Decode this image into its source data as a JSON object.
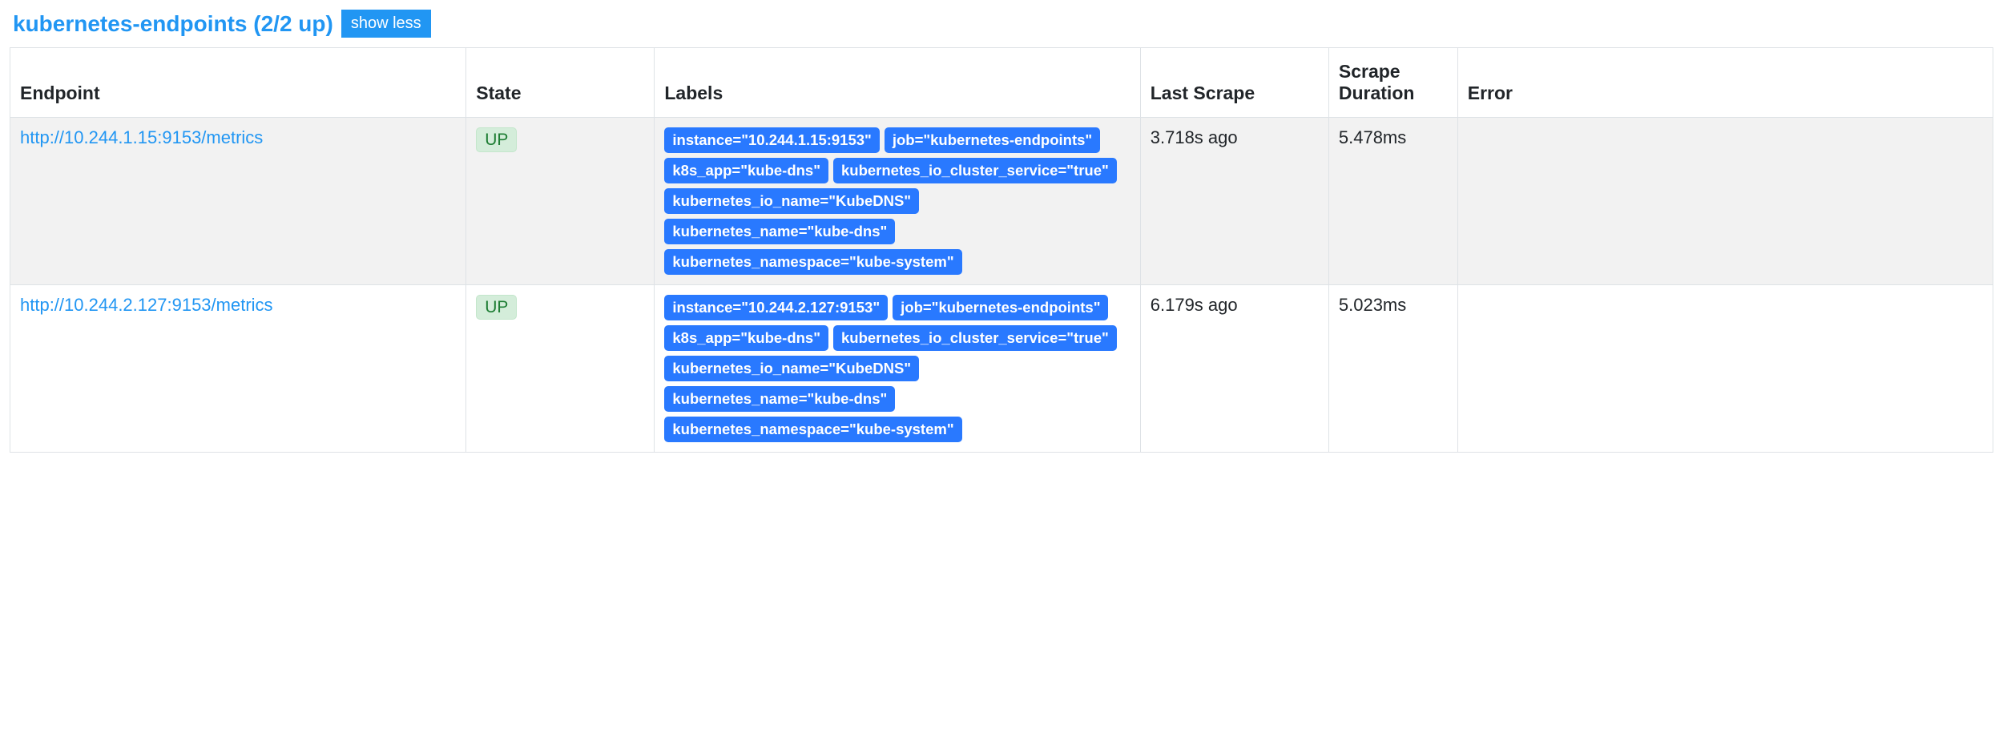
{
  "header": {
    "title": "kubernetes-endpoints (2/2 up)",
    "toggle_label": "show less"
  },
  "table": {
    "columns": {
      "endpoint": "Endpoint",
      "state": "State",
      "labels": "Labels",
      "last_scrape": "Last Scrape",
      "scrape_duration": "Scrape Duration",
      "error": "Error"
    },
    "rows": [
      {
        "endpoint": "http://10.244.1.15:9153/metrics",
        "state": "UP",
        "labels": [
          "instance=\"10.244.1.15:9153\"",
          "job=\"kubernetes-endpoints\"",
          "k8s_app=\"kube-dns\"",
          "kubernetes_io_cluster_service=\"true\"",
          "kubernetes_io_name=\"KubeDNS\"",
          "kubernetes_name=\"kube-dns\"",
          "kubernetes_namespace=\"kube-system\""
        ],
        "last_scrape": "3.718s ago",
        "scrape_duration": "5.478ms",
        "error": ""
      },
      {
        "endpoint": "http://10.244.2.127:9153/metrics",
        "state": "UP",
        "labels": [
          "instance=\"10.244.2.127:9153\"",
          "job=\"kubernetes-endpoints\"",
          "k8s_app=\"kube-dns\"",
          "kubernetes_io_cluster_service=\"true\"",
          "kubernetes_io_name=\"KubeDNS\"",
          "kubernetes_name=\"kube-dns\"",
          "kubernetes_namespace=\"kube-system\""
        ],
        "last_scrape": "6.179s ago",
        "scrape_duration": "5.023ms",
        "error": ""
      }
    ]
  }
}
